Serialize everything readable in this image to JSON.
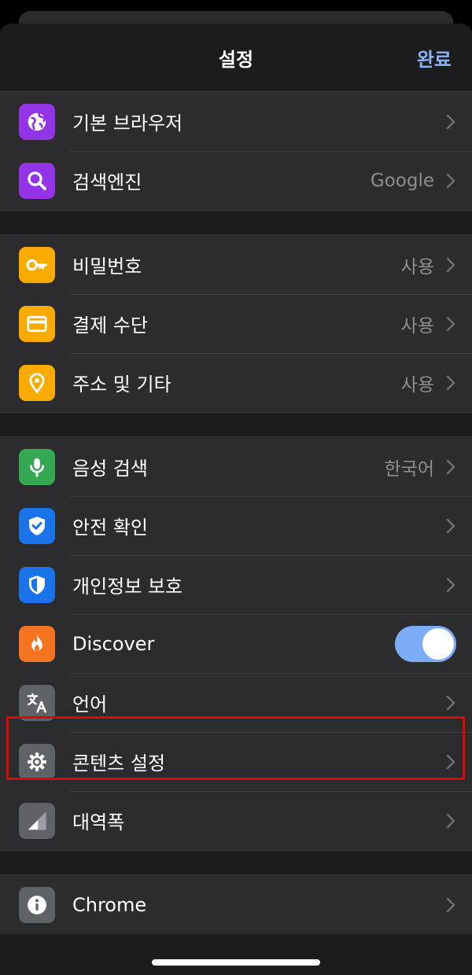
{
  "nav": {
    "title": "설정",
    "done_label": "완료"
  },
  "groups": [
    {
      "rows": [
        {
          "label": "기본 브라우저",
          "value": "",
          "icon": "globe-icon",
          "color": "#9334e6"
        },
        {
          "label": "검색엔진",
          "value": "Google",
          "icon": "search-icon",
          "color": "#9334e6"
        }
      ]
    },
    {
      "rows": [
        {
          "label": "비밀번호",
          "value": "사용",
          "icon": "key-icon",
          "color": "#f9ab00"
        },
        {
          "label": "결제 수단",
          "value": "사용",
          "icon": "credit-card-icon",
          "color": "#f9ab00"
        },
        {
          "label": "주소 및 기타",
          "value": "사용",
          "icon": "location-pin-icon",
          "color": "#f9ab00"
        }
      ]
    },
    {
      "rows": [
        {
          "label": "음성 검색",
          "value": "한국어",
          "icon": "microphone-icon",
          "color": "#34a853"
        },
        {
          "label": "안전 확인",
          "value": "",
          "icon": "shield-check-icon",
          "color": "#1a73e8"
        },
        {
          "label": "개인정보 보호",
          "value": "",
          "icon": "shield-icon",
          "color": "#1a73e8"
        },
        {
          "label": "Discover",
          "toggle": true,
          "icon": "flame-icon",
          "color": "#f47321"
        },
        {
          "label": "언어",
          "value": "",
          "icon": "translate-icon",
          "color": "#5f6368"
        },
        {
          "label": "콘텐츠 설정",
          "value": "",
          "icon": "gear-icon",
          "color": "#5f6368"
        },
        {
          "label": "대역폭",
          "value": "",
          "icon": "signal-icon",
          "color": "#5f6368"
        }
      ]
    },
    {
      "rows": [
        {
          "label": "Chrome",
          "value": "",
          "icon": "info-icon",
          "color": "#5f6368"
        }
      ]
    }
  ],
  "colors": {
    "accent": "#8ab4f8",
    "toggle_on": "#7cacf8",
    "highlight": "#e10600"
  }
}
